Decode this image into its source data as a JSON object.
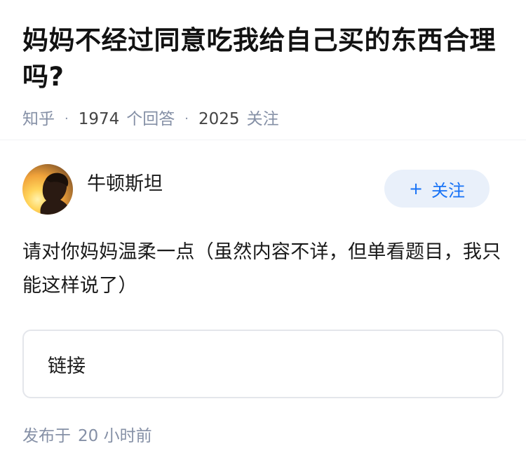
{
  "question": {
    "title": "妈妈不经过同意吃我给自己买的东西合理吗?",
    "source": "知乎",
    "answer_count": "1974",
    "answer_count_label": "个回答",
    "follower_count": "2025",
    "follower_label": "关注",
    "separator": "·"
  },
  "answer": {
    "author": {
      "name": "牛顿斯坦",
      "avatar_icon": "person-silhouette-sunset-avatar"
    },
    "follow_button": {
      "icon": "+",
      "label": "关注"
    },
    "content": "请对你妈妈温柔一点（虽然内容不详，但单看题目，我只能这样说了）",
    "link_card_label": "链接",
    "published": {
      "prefix": "发布于",
      "time": "20 小时前"
    }
  },
  "colors": {
    "accent": "#1772f6",
    "follow_bg": "#e9f0fa",
    "meta_gray": "#8590a6"
  }
}
